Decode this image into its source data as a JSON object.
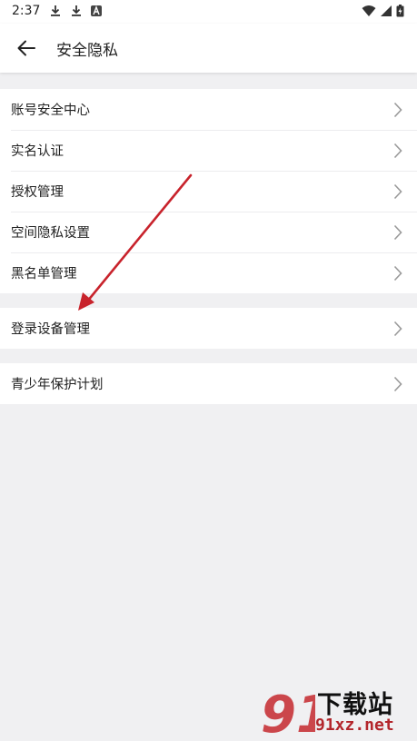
{
  "status_bar": {
    "time": "2:37",
    "left_icons": [
      "download-icon",
      "download-icon",
      "app-notification-icon"
    ],
    "right_icons": [
      "wifi-icon",
      "signal-icon",
      "battery-icon"
    ]
  },
  "app_bar": {
    "back_icon": "back-arrow-icon",
    "title": "安全隐私"
  },
  "groups": [
    {
      "items": [
        {
          "label": "账号安全中心"
        },
        {
          "label": "实名认证"
        },
        {
          "label": "授权管理"
        },
        {
          "label": "空间隐私设置"
        },
        {
          "label": "黑名单管理"
        }
      ]
    },
    {
      "items": [
        {
          "label": "登录设备管理"
        }
      ]
    },
    {
      "items": [
        {
          "label": "青少年保护计划"
        }
      ]
    }
  ],
  "annotation": {
    "arrow_color": "#c8232c"
  },
  "watermark": {
    "title": "下载站",
    "domain": "91xz.net",
    "logo_text": "91"
  },
  "colors": {
    "background": "#f0f0f2",
    "surface": "#ffffff",
    "text": "#222222",
    "chevron": "#9a9a9a",
    "watermark_red": "#b3262c"
  }
}
